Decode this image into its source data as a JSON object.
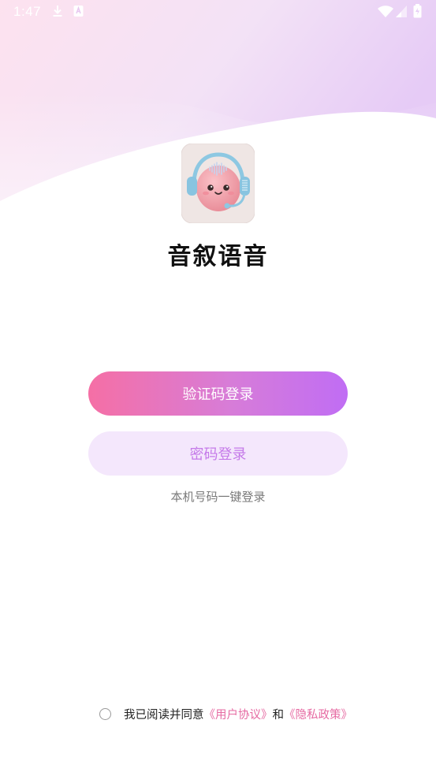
{
  "status_bar": {
    "time": "1:47",
    "icons": [
      "download-icon",
      "app-notification-icon",
      "wifi-icon",
      "signal-icon",
      "battery-icon"
    ]
  },
  "app": {
    "name": "音叙语音",
    "logo": "headset-mascot-icon"
  },
  "buttons": {
    "code_login": "验证码登录",
    "password_login": "密码登录"
  },
  "one_key_login": "本机号码一键登录",
  "agreement": {
    "prefix": "我已阅读并同意",
    "user_agreement": "《用户协议》",
    "and": "和",
    "privacy_policy": "《隐私政策》",
    "checked": false
  },
  "colors": {
    "gradient_start": "#f56fa5",
    "gradient_end": "#c06df4",
    "secondary_button_bg": "#f4e7fc",
    "secondary_button_text": "#c57ae9",
    "link": "#e66aa2"
  }
}
